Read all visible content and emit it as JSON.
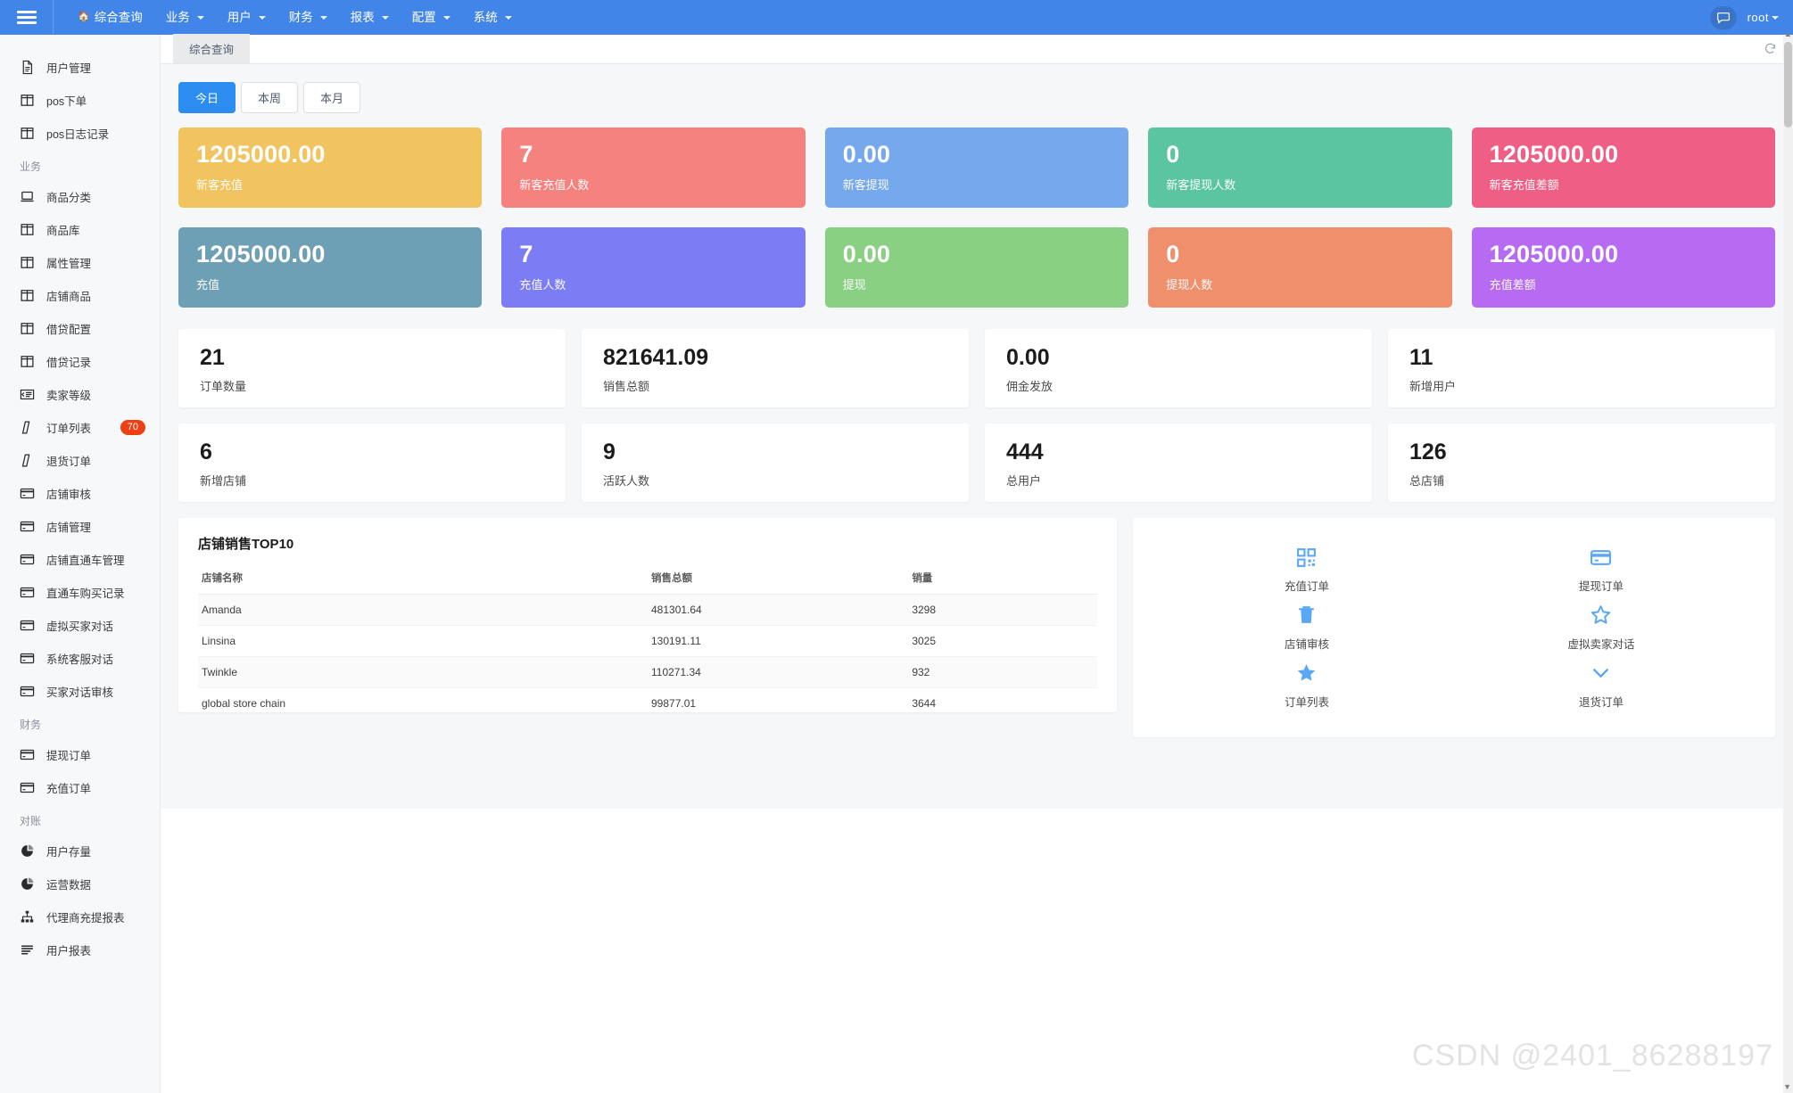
{
  "topnav": {
    "menu_icon": "hamburger-icon",
    "items": [
      {
        "label": "综合查询",
        "icon": "home-icon",
        "has_caret": false
      },
      {
        "label": "业务",
        "icon": "",
        "has_caret": true
      },
      {
        "label": "用户",
        "icon": "",
        "has_caret": true
      },
      {
        "label": "财务",
        "icon": "",
        "has_caret": true
      },
      {
        "label": "报表",
        "icon": "",
        "has_caret": true
      },
      {
        "label": "配置",
        "icon": "",
        "has_caret": true
      },
      {
        "label": "系统",
        "icon": "",
        "has_caret": true
      }
    ],
    "chat_icon": "chat-bubble-icon",
    "user": "root"
  },
  "tabstrip": {
    "tabs": [
      {
        "label": "综合查询",
        "active": true
      }
    ],
    "refresh_icon": "refresh-icon"
  },
  "sidebar": {
    "items": [
      {
        "type": "item",
        "label": "用户管理",
        "icon": "document-icon",
        "badge": ""
      },
      {
        "type": "item",
        "label": "pos下单",
        "icon": "columns-icon",
        "badge": ""
      },
      {
        "type": "item",
        "label": "pos日志记录",
        "icon": "columns-icon",
        "badge": ""
      },
      {
        "type": "group",
        "label": "业务"
      },
      {
        "type": "item",
        "label": "商品分类",
        "icon": "laptop-icon",
        "badge": ""
      },
      {
        "type": "item",
        "label": "商品库",
        "icon": "columns-icon",
        "badge": ""
      },
      {
        "type": "item",
        "label": "属性管理",
        "icon": "columns-icon",
        "badge": ""
      },
      {
        "type": "item",
        "label": "店铺商品",
        "icon": "columns-icon",
        "badge": ""
      },
      {
        "type": "item",
        "label": "借贷配置",
        "icon": "columns-icon",
        "badge": ""
      },
      {
        "type": "item",
        "label": "借贷记录",
        "icon": "columns-icon",
        "badge": ""
      },
      {
        "type": "item",
        "label": "卖家等级",
        "icon": "indent-icon",
        "badge": ""
      },
      {
        "type": "item",
        "label": "订单列表",
        "icon": "slash-icon",
        "badge": "70"
      },
      {
        "type": "item",
        "label": "退货订单",
        "icon": "slash-icon",
        "badge": ""
      },
      {
        "type": "item",
        "label": "店铺审核",
        "icon": "card-icon",
        "badge": ""
      },
      {
        "type": "item",
        "label": "店铺管理",
        "icon": "card-icon",
        "badge": ""
      },
      {
        "type": "item",
        "label": "店铺直通车管理",
        "icon": "card-icon",
        "badge": ""
      },
      {
        "type": "item",
        "label": "直通车购买记录",
        "icon": "card-icon",
        "badge": ""
      },
      {
        "type": "item",
        "label": "虚拟买家对话",
        "icon": "card-icon",
        "badge": ""
      },
      {
        "type": "item",
        "label": "系统客服对话",
        "icon": "card-icon",
        "badge": ""
      },
      {
        "type": "item",
        "label": "买家对话审核",
        "icon": "card-icon",
        "badge": ""
      },
      {
        "type": "group",
        "label": "财务"
      },
      {
        "type": "item",
        "label": "提现订单",
        "icon": "card-icon",
        "badge": ""
      },
      {
        "type": "item",
        "label": "充值订单",
        "icon": "card-icon",
        "badge": ""
      },
      {
        "type": "group",
        "label": "对账"
      },
      {
        "type": "item",
        "label": "用户存量",
        "icon": "pie-chart-icon",
        "badge": ""
      },
      {
        "type": "item",
        "label": "运营数据",
        "icon": "pie-chart-icon",
        "badge": ""
      },
      {
        "type": "item",
        "label": "代理商充提报表",
        "icon": "sitemap-icon",
        "badge": ""
      },
      {
        "type": "item",
        "label": "用户报表",
        "icon": "bars-icon",
        "badge": ""
      }
    ]
  },
  "filters": [
    {
      "label": "今日",
      "active": true
    },
    {
      "label": "本周",
      "active": false
    },
    {
      "label": "本月",
      "active": false
    }
  ],
  "color_cards_row1": [
    {
      "value": "1205000.00",
      "label": "新客充值",
      "color": "#f2c45f"
    },
    {
      "value": "7",
      "label": "新客充值人数",
      "color": "#f5827f"
    },
    {
      "value": "0.00",
      "label": "新客提现",
      "color": "#75a8ec"
    },
    {
      "value": "0",
      "label": "新客提现人数",
      "color": "#5bc4a0"
    },
    {
      "value": "1205000.00",
      "label": "新客充值差额",
      "color": "#ef5f85"
    }
  ],
  "color_cards_row2": [
    {
      "value": "1205000.00",
      "label": "充值",
      "color": "#6d9fb5"
    },
    {
      "value": "7",
      "label": "充值人数",
      "color": "#7c7cf5"
    },
    {
      "value": "0.00",
      "label": "提现",
      "color": "#8ad083"
    },
    {
      "value": "0",
      "label": "提现人数",
      "color": "#f08f6c"
    },
    {
      "value": "1205000.00",
      "label": "充值差额",
      "color": "#b66bf2"
    }
  ],
  "white_cards": [
    {
      "value": "21",
      "label": "订单数量"
    },
    {
      "value": "821641.09",
      "label": "销售总额"
    },
    {
      "value": "0.00",
      "label": "佣金发放"
    },
    {
      "value": "11",
      "label": "新增用户"
    },
    {
      "value": "6",
      "label": "新增店铺"
    },
    {
      "value": "9",
      "label": "活跃人数"
    },
    {
      "value": "444",
      "label": "总用户"
    },
    {
      "value": "126",
      "label": "总店铺"
    }
  ],
  "top10": {
    "title": "店铺销售TOP10",
    "columns": [
      "店铺名称",
      "销售总额",
      "销量"
    ],
    "rows": [
      [
        "Amanda",
        "481301.64",
        "3298"
      ],
      [
        "Linsina",
        "130191.11",
        "3025"
      ],
      [
        "Twinkle",
        "110271.34",
        "932"
      ],
      [
        "global store chain",
        "99877.01",
        "3644"
      ]
    ]
  },
  "shortcuts": [
    {
      "label": "充值订单",
      "icon": "qrcode-icon"
    },
    {
      "label": "提现订单",
      "icon": "credit-card-icon"
    },
    {
      "label": "店铺审核",
      "icon": "trash-icon"
    },
    {
      "label": "虚拟卖家对话",
      "icon": "star-outline-icon"
    },
    {
      "label": "订单列表",
      "icon": "star-filled-icon"
    },
    {
      "label": "退货订单",
      "icon": "chevron-down-icon"
    }
  ],
  "watermark": "CSDN @2401_86288197",
  "colors": {
    "brand": "#4285e8",
    "accent": "#2d8cf0",
    "badge": "#ed4014",
    "shortcut_icon": "#5aa7f5"
  }
}
